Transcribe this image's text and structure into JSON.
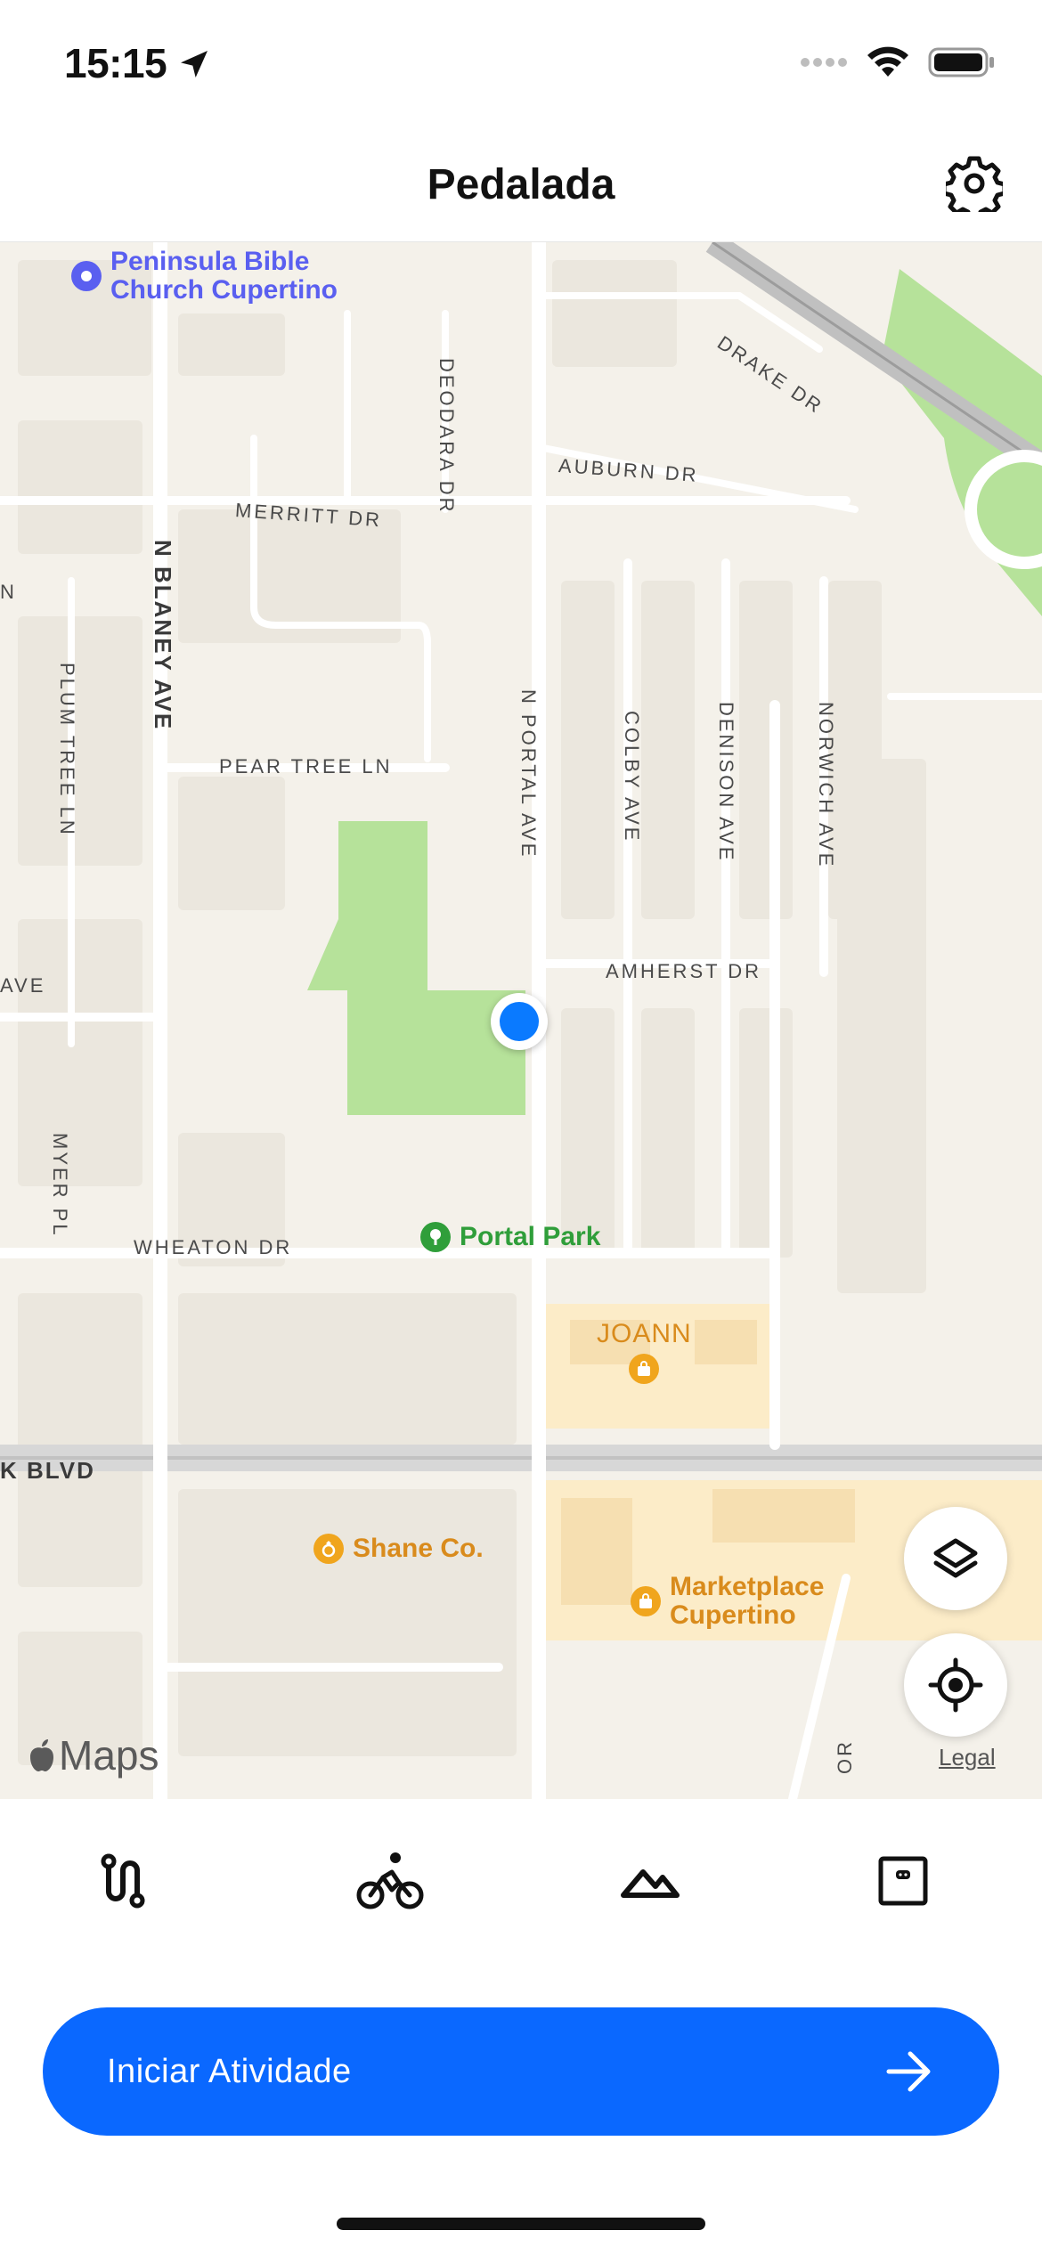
{
  "status_bar": {
    "time": "15:15",
    "icons": [
      "location-arrow-icon",
      "signal-dots-icon",
      "wifi-icon",
      "battery-icon"
    ]
  },
  "nav": {
    "title": "Pedalada",
    "settings_icon": "gear-icon"
  },
  "map": {
    "streets": [
      {
        "label": "DRAKE DR"
      },
      {
        "label": "AUBURN DR"
      },
      {
        "label": "MERRITT DR"
      },
      {
        "label": "DEODARA DR"
      },
      {
        "label": "N BLANEY AVE"
      },
      {
        "label": "PLUM TREE LN"
      },
      {
        "label": "PEAR TREE LN"
      },
      {
        "label": "N PORTAL AVE"
      },
      {
        "label": "COLBY AVE"
      },
      {
        "label": "DENISON AVE"
      },
      {
        "label": "NORWICH AVE"
      },
      {
        "label": "AMHERST DR"
      },
      {
        "label": "MYER PL"
      },
      {
        "label": "WHEATON DR"
      },
      {
        "label": "K BLVD"
      },
      {
        "label": "AVE"
      },
      {
        "label": "N"
      },
      {
        "label": "OR"
      }
    ],
    "pois": [
      {
        "label": "Peninsula Bible Church Cupertino",
        "line1": "Peninsula Bible",
        "line2": "Church Cupertino",
        "color": "#5a5ff0"
      },
      {
        "label": "Portal Park",
        "color": "#2f9e3a"
      },
      {
        "label": "JOANN",
        "color": "#d98b1c"
      },
      {
        "label": "Shane Co.",
        "color": "#d98b1c"
      },
      {
        "label": "Marketplace Cupertino",
        "line1": "Marketplace",
        "line2": "Cupertino",
        "color": "#d98b1c"
      }
    ],
    "attribution": "Maps",
    "legal": "Legal",
    "layers_button_icon": "layers-icon",
    "locate_button_icon": "locate-crosshair-icon"
  },
  "tabs": [
    {
      "icon": "route-icon"
    },
    {
      "icon": "bicycle-rider-icon"
    },
    {
      "icon": "mountain-elevation-icon"
    },
    {
      "icon": "display-screen-icon"
    }
  ],
  "cta": {
    "label": "Iniciar Atividade",
    "icon": "arrow-right-icon"
  },
  "colors": {
    "accent": "#0a68ff",
    "user_location": "#0a7aff",
    "park_green": "#b6e29a",
    "commercial": "#fcecc8"
  }
}
